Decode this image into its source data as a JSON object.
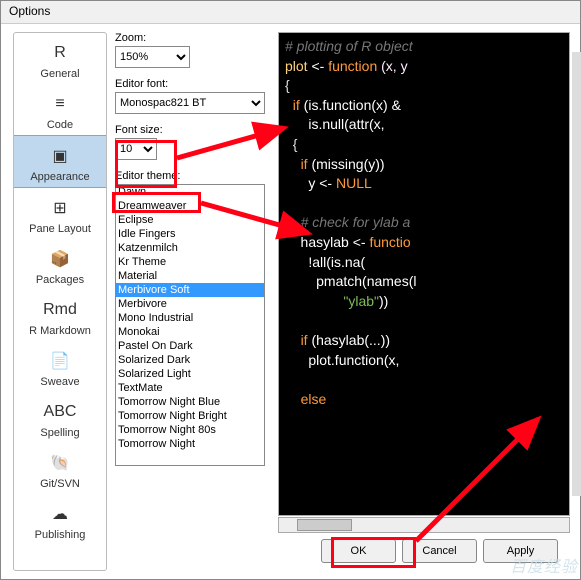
{
  "window": {
    "title": "Options"
  },
  "sidebar": {
    "items": [
      {
        "label": "General",
        "icon": "R"
      },
      {
        "label": "Code",
        "icon": "≡"
      },
      {
        "label": "Appearance",
        "icon": "▣"
      },
      {
        "label": "Pane Layout",
        "icon": "⊞"
      },
      {
        "label": "Packages",
        "icon": "📦"
      },
      {
        "label": "R Markdown",
        "icon": "Rmd"
      },
      {
        "label": "Sweave",
        "icon": "📄"
      },
      {
        "label": "Spelling",
        "icon": "ABC"
      },
      {
        "label": "Git/SVN",
        "icon": "🐚"
      },
      {
        "label": "Publishing",
        "icon": "☁"
      }
    ],
    "selected": "Appearance"
  },
  "form": {
    "zoom_label": "Zoom:",
    "zoom_value": "150%",
    "editor_font_label": "Editor font:",
    "editor_font_value": "Monospac821 BT",
    "font_size_label": "Font size:",
    "font_size_value": "10",
    "editor_theme_label": "Editor theme:",
    "themes": [
      "Dawn",
      "Dreamweaver",
      "Eclipse",
      "Idle Fingers",
      "Katzenmilch",
      "Kr Theme",
      "Material",
      "Merbivore Soft",
      "Merbivore",
      "Mono Industrial",
      "Monokai",
      "Pastel On Dark",
      "Solarized Dark",
      "Solarized Light",
      "TextMate",
      "Tomorrow Night Blue",
      "Tomorrow Night Bright",
      "Tomorrow Night 80s",
      "Tomorrow Night"
    ],
    "theme_selected": "Merbivore Soft"
  },
  "preview": {
    "lines": [
      [
        {
          "t": "# plotting of R object",
          "c": "cm"
        }
      ],
      [
        {
          "t": "plot",
          "c": "fn"
        },
        {
          "t": " <- ",
          "c": "op"
        },
        {
          "t": "function",
          "c": "kw"
        },
        {
          "t": " (x, y",
          "c": "arg"
        }
      ],
      [
        {
          "t": "{",
          "c": "br"
        }
      ],
      [
        {
          "t": "  ",
          "c": "op"
        },
        {
          "t": "if",
          "c": "kw"
        },
        {
          "t": " (is.function(x) &",
          "c": "op"
        }
      ],
      [
        {
          "t": "      is.null(attr(x,",
          "c": "op"
        }
      ],
      [
        {
          "t": "  {",
          "c": "br"
        }
      ],
      [
        {
          "t": "    ",
          "c": "op"
        },
        {
          "t": "if",
          "c": "kw"
        },
        {
          "t": " (missing(y))",
          "c": "op"
        }
      ],
      [
        {
          "t": "      y <- ",
          "c": "op"
        },
        {
          "t": "NULL",
          "c": "kw"
        }
      ],
      [],
      [
        {
          "t": "    ",
          "c": "op"
        },
        {
          "t": "# check for ylab a",
          "c": "cm"
        }
      ],
      [
        {
          "t": "    hasylab <- ",
          "c": "op"
        },
        {
          "t": "functio",
          "c": "kw"
        }
      ],
      [
        {
          "t": "      !all(is.na(",
          "c": "op"
        }
      ],
      [
        {
          "t": "        pmatch(names(l",
          "c": "op"
        }
      ],
      [
        {
          "t": "               ",
          "c": "op"
        },
        {
          "t": "\"ylab\"",
          "c": "str"
        },
        {
          "t": "))",
          "c": "op"
        }
      ],
      [],
      [
        {
          "t": "    ",
          "c": "op"
        },
        {
          "t": "if",
          "c": "kw"
        },
        {
          "t": " (hasylab(...))",
          "c": "op"
        }
      ],
      [
        {
          "t": "      plot.function(x,",
          "c": "op"
        }
      ],
      [],
      [
        {
          "t": "    ",
          "c": "op"
        },
        {
          "t": "else",
          "c": "kw"
        }
      ]
    ]
  },
  "buttons": {
    "ok": "OK",
    "cancel": "Cancel",
    "apply": "Apply"
  },
  "watermark": "百度经验"
}
